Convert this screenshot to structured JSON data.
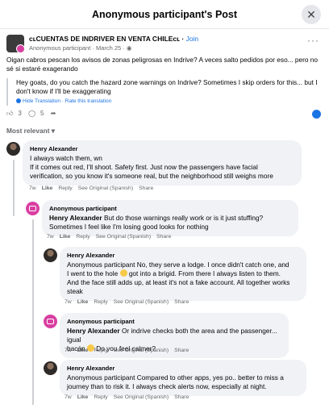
{
  "header": {
    "title": "Anonymous participant's Post",
    "close_icon": "✕"
  },
  "post": {
    "group_name": "ᴄʟCUENTAS DE INDRIVER EN VENTA CHILEᴄʟ",
    "join_label": "Join",
    "author": "Anonymous participant",
    "date": "March 25",
    "more_icon": "···",
    "text": "Oigan cabros pescan los avisos de zonas peligrosas en Indrive? A veces salto pedidos por eso... pero no sé si estaré exagerando",
    "translation": "Hey goats, do you catch the hazard zone warnings on Indrive? Sometimes I skip orders for this... but I don't know if I'll be exaggerating",
    "hide_translation": "Hide Translation",
    "rate_translation": "Rate this translation",
    "reaction_count": "3",
    "comment_count": "5",
    "sort_label": "Most relevant"
  },
  "comments": [
    {
      "author": "Henry Alexander",
      "lines": [
        "I always watch them, wn",
        "If it comes out red, I'll shoot. Safety first. Just now the passengers have facial",
        "verification, so you know it's someone real, but the neighborhood still weighs more"
      ],
      "time": "7w"
    },
    {
      "author": "Anonymous participant",
      "mention": "Henry Alexander",
      "lines_rest": " But do those warnings really work or is it just stuffing?",
      "line2": "Sometimes I feel like I'm losing good looks for nothing",
      "time": "7w"
    },
    {
      "author": "Henry Alexander",
      "lines": [
        "Anonymous participant No, they serve a lodge. I once didn't catch one, and",
        "I went to the hole",
        " got into a brigid. From there I always listen to them.",
        "And the face still adds up, at least it's not a fake account. All together works",
        "steak"
      ],
      "time": "7w"
    },
    {
      "author": "Anonymous participant",
      "mention": "Henry Alexander",
      "line1_rest": " Or indrive checks both the area and the passenger... igual",
      "line2": "bacán",
      "line2_rest": " Do you feel calmer?",
      "time": "7w"
    },
    {
      "author": "Henry Alexander",
      "lines": [
        "Anonymous participant Compared to other apps, yes po.. better to miss a",
        "journey than to risk it. I always check alerts now, especially at night."
      ],
      "time": "7w"
    }
  ],
  "actions": {
    "like": "Like",
    "reply": "Reply",
    "see_original": "See Original (Spanish)",
    "share": "Share"
  }
}
